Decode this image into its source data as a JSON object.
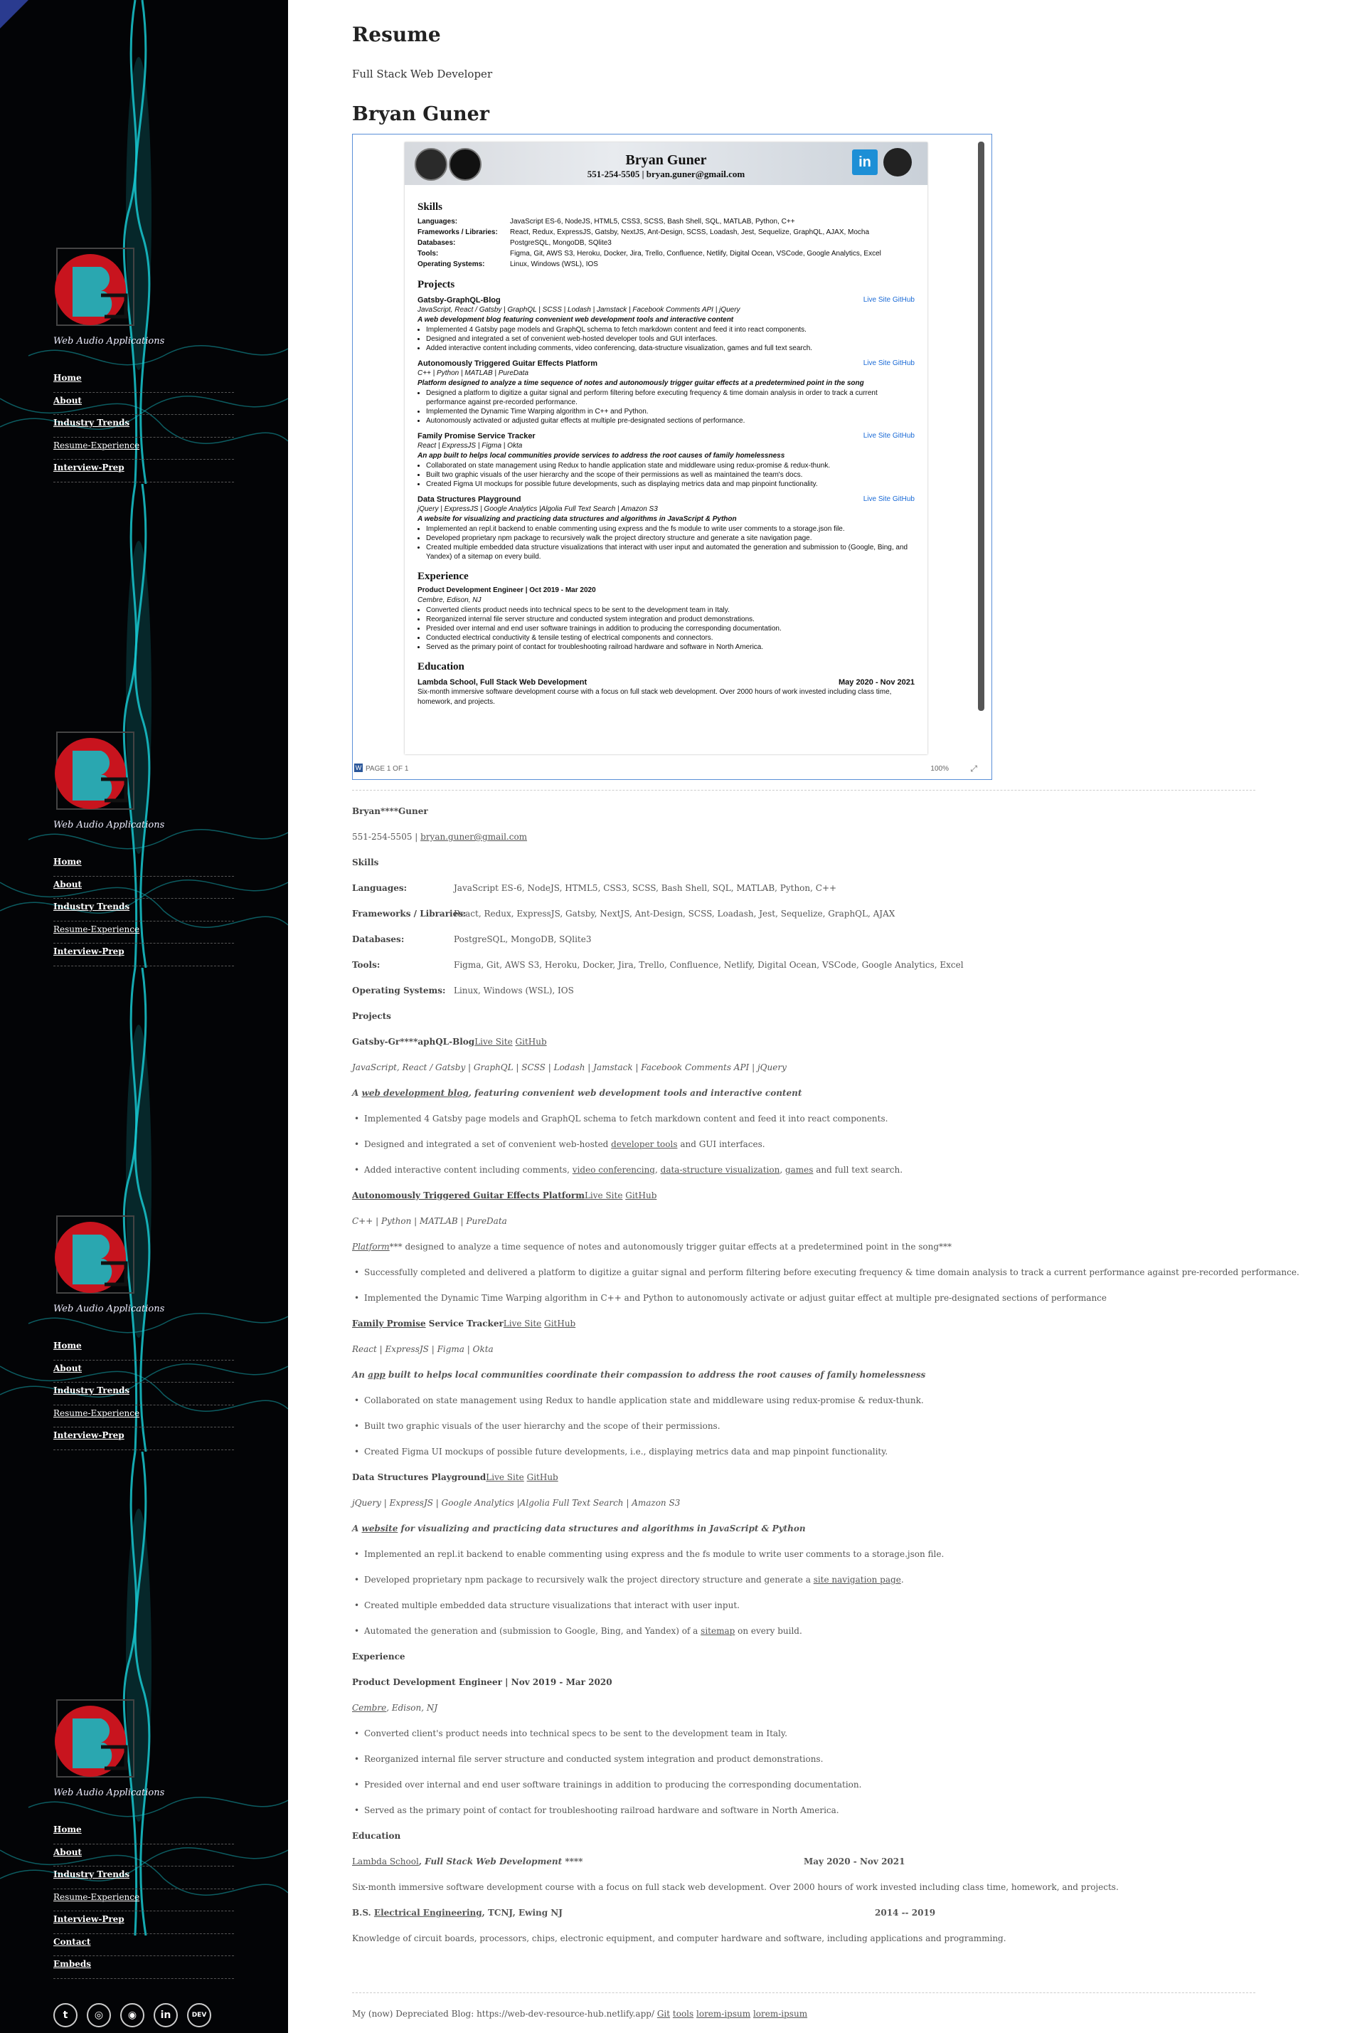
{
  "sidebar": {
    "tagline": "Web Audio Applications",
    "nav": [
      "Home",
      "About",
      "Industry Trends",
      "Resume-Experience",
      "Interview-Prep",
      "Contact",
      "Embeds"
    ],
    "social": [
      {
        "icon": "twitter-icon",
        "glyph": "t"
      },
      {
        "icon": "instagram-icon",
        "glyph": "◎"
      },
      {
        "icon": "github-icon",
        "glyph": "◉"
      },
      {
        "icon": "linkedin-icon",
        "glyph": "in"
      },
      {
        "icon": "dev-icon",
        "glyph": "DEV"
      }
    ],
    "accent": "#18c8d0"
  },
  "main": {
    "page_title": "Resume",
    "subtitle": "Full Stack Web Developer",
    "name": "Bryan Guner"
  },
  "viewer": {
    "name": "Bryan Guner",
    "contact": "551-254-5505 | bryan.guner@gmail.com",
    "skills_heading": "Skills",
    "skills": [
      {
        "k": "Languages:",
        "v": "JavaScript ES-6, NodeJS, HTML5, CSS3, SCSS, Bash Shell, SQL, MATLAB, Python, C++"
      },
      {
        "k": "Frameworks / Libraries:",
        "v": "React, Redux, ExpressJS, Gatsby, NextJS, Ant-Design, SCSS, Loadash, Jest, Sequelize, GraphQL, AJAX, Mocha"
      },
      {
        "k": "Databases:",
        "v": "PostgreSQL, MongoDB, SQlite3"
      },
      {
        "k": "Tools:",
        "v": "Figma, Git, AWS S3, Heroku, Docker, Jira, Trello, Confluence, Netlify, Digital Ocean, VSCode, Google Analytics, Excel"
      },
      {
        "k": "Operating Systems:",
        "v": "Linux, Windows (WSL), IOS"
      }
    ],
    "projects_heading": "Projects",
    "projects": [
      {
        "title": "Gatsby-GraphQL-Blog",
        "links": "Live Site   GitHub",
        "stack": "JavaScript, React / Gatsby | GraphQL | SCSS | Lodash | Jamstack | Facebook Comments API | jQuery",
        "desc": "A web development blog featuring convenient web development tools and interactive content",
        "bullets": [
          "Implemented 4 Gatsby page models and GraphQL schema to fetch markdown content and feed it into react components.",
          "Designed and integrated a set of convenient web-hosted developer tools and GUI interfaces.",
          "Added interactive content including comments, video conferencing, data-structure visualization, games and full text search."
        ]
      },
      {
        "title": "Autonomously Triggered Guitar Effects Platform",
        "links": "Live Site   GitHub",
        "stack": "C++ | Python | MATLAB | PureData",
        "desc": "Platform designed to analyze a time sequence of notes and autonomously trigger guitar effects at a predetermined point in the song",
        "bullets": [
          "Designed a platform to digitize a guitar signal and perform filtering before executing frequency & time domain analysis in order to track a current performance against pre-recorded performance.",
          "Implemented the Dynamic Time Warping algorithm in C++ and Python.",
          "Autonomously activated or adjusted guitar effects at multiple pre-designated sections of performance."
        ]
      },
      {
        "title": "Family Promise Service Tracker",
        "links": "Live Site   GitHub",
        "stack": "React | ExpressJS | Figma | Okta",
        "desc": "An app built to helps local communities provide services to address the root causes of family homelessness",
        "bullets": [
          "Collaborated on state management using Redux to handle application state and middleware using redux-promise & redux-thunk.",
          "Built two graphic visuals of the user hierarchy and the scope of their permissions as well as maintained the team's docs.",
          "Created Figma UI mockups for possible future developments, such as displaying metrics data and map pinpoint functionality."
        ]
      },
      {
        "title": "Data Structures Playground",
        "links": "Live Site   GitHub",
        "stack": "jQuery | ExpressJS | Google Analytics |Algolia Full Text Search | Amazon S3",
        "desc": "A website for visualizing and practicing data structures and algorithms in JavaScript & Python",
        "bullets": [
          "Implemented an repl.it backend to enable commenting using express and the fs module to write user comments to a storage.json file.",
          "Developed proprietary npm package to recursively walk the project directory structure and generate a site navigation page.",
          "Created multiple embedded data structure visualizations that interact with user input and automated the generation and submission to (Google, Bing, and Yandex) of a sitemap on every build."
        ]
      }
    ],
    "experience_heading": "Experience",
    "job": "Product Development Engineer | Oct 2019 - Mar 2020",
    "company": "Cembre, Edison, NJ",
    "job_bullets": [
      "Converted clients product needs into technical specs to be sent to the development team in Italy.",
      "Reorganized internal file server structure and conducted system integration and product demonstrations.",
      "Presided over internal and end user software trainings in addition to producing the corresponding documentation.",
      "Conducted electrical conductivity & tensile testing of electrical components and connectors.",
      "Served as the primary point of contact for troubleshooting railroad hardware and software in North America."
    ],
    "education_heading": "Education",
    "school": "Lambda School, Full Stack Web Development",
    "school_dates": "May 2020 - Nov 2021",
    "school_desc": "Six-month immersive software development course with a focus on full stack web development. Over 2000 hours of work invested including class time, homework, and projects.",
    "footer_page": "PAGE 1 OF 1",
    "footer_zoom": "100%"
  },
  "text": {
    "name": "Bryan****Guner",
    "phone": "551-254-5505 | ",
    "email": "bryan.guner@gmail.com",
    "skills": "Skills",
    "kv": [
      {
        "k": "Languages:",
        "v": "JavaScript ES-6, NodeJS, HTML5, CSS3, SCSS, Bash Shell, SQL, MATLAB, Python, C++"
      },
      {
        "k": "Frameworks / Libraries:",
        "v": "React, Redux, ExpressJS, Gatsby, NextJS, Ant-Design, SCSS, Loadash, Jest, Sequelize, GraphQL, AJAX"
      },
      {
        "k": "Databases:",
        "v": "PostgreSQL, MongoDB, SQlite3"
      },
      {
        "k": "Tools:",
        "v": "Figma, Git, AWS S3, Heroku, Docker, Jira, Trello, Confluence, Netlify, Digital Ocean, VSCode, Google Analytics, Excel"
      },
      {
        "k": "Operating Systems:",
        "v": "Linux, Windows (WSL), IOS"
      }
    ],
    "projects": "Projects",
    "p1_title": "Gatsby-Gr****aphQL-Blog",
    "p1_stack": "JavaScript, React / Gatsby | GraphQL | SCSS | Lodash | Jamstack | Facebook Comments API | jQuery",
    "p1_desc_a": "A ",
    "p1_desc_link": "web development blog",
    "p1_desc_b": ", featuring convenient web development tools and interactive content",
    "p1_b1": "Implemented 4 Gatsby page models and GraphQL schema to fetch markdown content and feed it into react components.",
    "p1_b2a": "Designed and integrated a set of convenient web-hosted ",
    "p1_b2link": "developer tools",
    "p1_b2b": " and GUI interfaces.",
    "p1_b3a": "Added interactive content including comments, ",
    "p1_b3l1": "video conferencing",
    "p1_b3l2": "data-structure visualization",
    "p1_b3l3": "games",
    "p1_b3b": " and full text search.",
    "p2_title": "Autonomously Triggered Guitar Effects Platform",
    "p2_stack": "C++ | Python | MATLAB | PureData",
    "p2_desc_link": "Platform",
    "p2_desc": "*** designed to analyze a time sequence of notes and autonomously trigger guitar effects at a predetermined point in the song***",
    "p2_b1": "Successfully completed and delivered a platform to digitize a guitar signal and perform filtering before executing frequency & time domain analysis to track a current performance against pre-recorded performance.",
    "p2_b2": "Implemented the Dynamic Time Warping algorithm in C++ and Python to autonomously activate or adjust guitar effect at multiple pre-designated sections of performance",
    "p3_title_link": "Family Promise",
    "p3_title": " Service Tracker",
    "p3_stack": "React | ExpressJS | Figma | Okta",
    "p3_desc_a": "An ",
    "p3_desc_link": "app",
    "p3_desc_b": " built to helps local communities coordinate their compassion to address the root causes of family homelessness",
    "p3_b1": "Collaborated on state management using Redux to handle application state and middleware using redux-promise & redux-thunk.",
    "p3_b2": "Built two graphic visuals of the user hierarchy and the scope of their permissions.",
    "p3_b3": "Created Figma UI mockups of possible future developments, i.e., displaying metrics data and map pinpoint functionality.",
    "p4_title": "Data Structures Playground",
    "p4_stack": "jQuery | ExpressJS | Google Analytics |Algolia Full Text Search | Amazon S3",
    "p4_desc_a": "A ",
    "p4_desc_link": "website",
    "p4_desc_b": " for visualizing and practicing data structures and algorithms in JavaScript & Python",
    "p4_b1": "Implemented an repl.it backend to enable commenting using express and the fs module to write user comments to a storage.json file.",
    "p4_b2a": "Developed proprietary npm package to recursively walk the project directory structure and generate a ",
    "p4_b2link": "site navigation page",
    "p4_b2b": ".",
    "p4_b3": "Created multiple embedded data structure visualizations that interact with user input.",
    "p4_b4a": "Automated the generation and (submission to Google, Bing, and Yandex) of a ",
    "p4_b4link": "sitemap",
    "p4_b4b": " on every build.",
    "live_site": "Live Site",
    "github": "GitHub",
    "experience": "Experience",
    "job": "Product Development Engineer | Nov 2019 - Mar 2020",
    "company_link": "Cembre",
    "company_rest": ", Edison, NJ",
    "e1": "Converted client's product needs into technical specs to be sent to the development team in Italy.",
    "e2": "Reorganized internal file server structure and conducted system integration and product demonstrations.",
    "e3": "Presided over internal and end user software trainings in addition to producing the corresponding documentation.",
    "e4": "Served as the primary point of contact for troubleshooting railroad hardware and software in North America.",
    "education": "Education",
    "school_link": "Lambda School",
    "school_rest": ", Full Stack Web Development ****",
    "school_dates": "May 2020 - Nov 2021",
    "school_desc": "Six-month immersive software development course with a focus on full stack web development. Over 2000 hours of work invested including class time, homework, and projects.",
    "bs_a": "B.S. ",
    "bs_link": "Electrical Engineering",
    "bs_b": ", TCNJ, Ewing NJ",
    "bs_dates": "2014 -- 2019",
    "bs_desc": "Knowledge of circuit boards, processors, chips, electronic equipment, and computer hardware and software, including applications and programming.",
    "footer_a": "My (now) Depreciated Blog: https://web-dev-resource-hub.netlify.app/ ",
    "footer_l1": "Git",
    "footer_l2": "tools",
    "footer_l3": "lorem-ipsum",
    "footer_l4": "lorem-ipsum"
  }
}
